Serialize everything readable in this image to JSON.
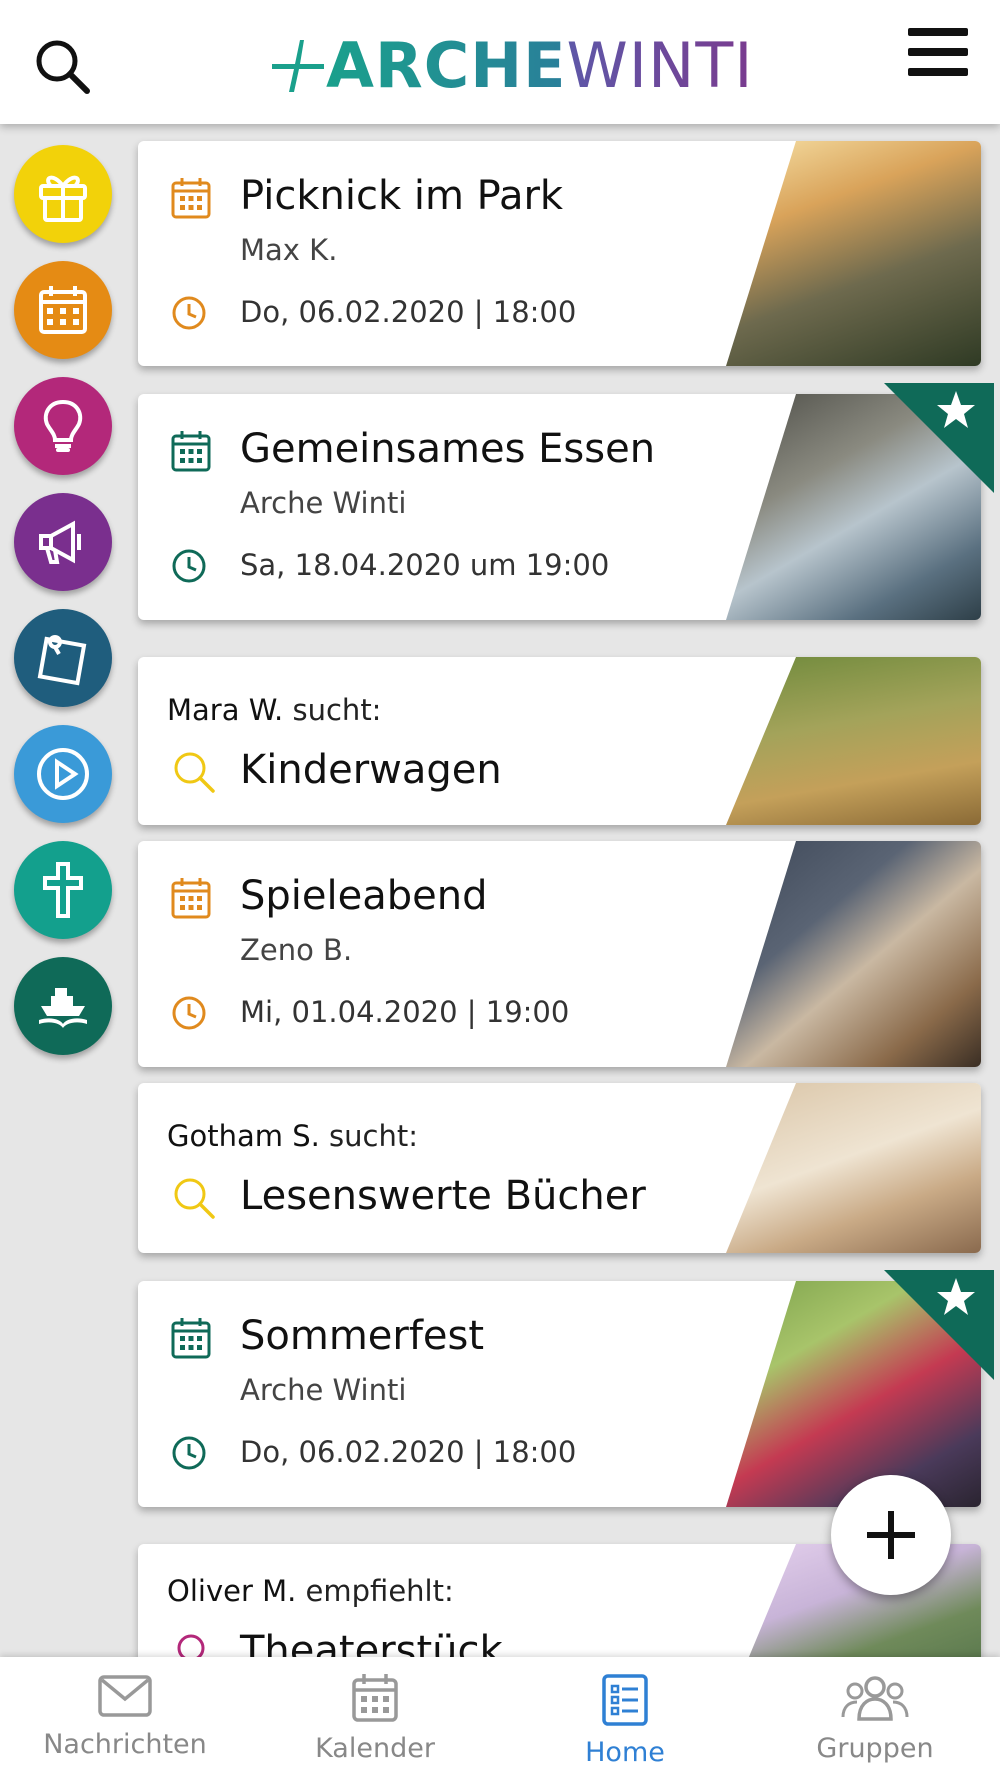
{
  "header": {
    "logo_part1": "ARCHE",
    "logo_part2": "WINTI"
  },
  "side_categories": [
    {
      "name": "gift",
      "color": "#f2d20a"
    },
    {
      "name": "calendar",
      "color": "#e58b14"
    },
    {
      "name": "idea",
      "color": "#b3287a"
    },
    {
      "name": "megaphone",
      "color": "#7a2f8e"
    },
    {
      "name": "note",
      "color": "#1f5d7d"
    },
    {
      "name": "play",
      "color": "#3a9ad8"
    },
    {
      "name": "cross",
      "color": "#13a08d"
    },
    {
      "name": "book-ship",
      "color": "#0f6a58"
    }
  ],
  "cards": [
    {
      "type": "event",
      "title": "Picknick im Park",
      "organizer": "Max K.",
      "date": "Do, 06.02.2020 | 18:00",
      "icon_color": "#e08a1e"
    },
    {
      "type": "event",
      "title": "Gemeinsames Essen",
      "organizer": "Arche Winti",
      "date": "Sa, 18.04.2020 um 19:00",
      "icon_color": "#0f6a58",
      "starred": true
    },
    {
      "type": "wish",
      "user": "Mara W.",
      "verb": " sucht:",
      "title": "Kinderwagen"
    },
    {
      "type": "event",
      "title": "Spieleabend",
      "organizer": "Zeno B.",
      "date": "Mi, 01.04.2020 | 19:00",
      "icon_color": "#e08a1e"
    },
    {
      "type": "wish",
      "user": "Gotham S.",
      "verb": " sucht:",
      "title": "Lesenswerte Bücher"
    },
    {
      "type": "event",
      "title": "Sommerfest",
      "organizer": "Arche Winti",
      "date": "Do, 06.02.2020 | 18:00",
      "icon_color": "#0f6a58",
      "starred": true
    },
    {
      "type": "recommend",
      "user": "Oliver M.",
      "verb": " empfiehlt:",
      "title": "Theaterstück"
    }
  ],
  "bottom_nav": [
    {
      "label": "Nachrichten",
      "icon": "mail-icon"
    },
    {
      "label": "Kalender",
      "icon": "calendar-icon"
    },
    {
      "label": "Home",
      "icon": "home-list-icon",
      "active": true
    },
    {
      "label": "Gruppen",
      "icon": "group-icon"
    }
  ],
  "colors": {
    "active": "#2f80d4",
    "star_green": "#0f6a58",
    "search_yellow": "#f0c814"
  }
}
